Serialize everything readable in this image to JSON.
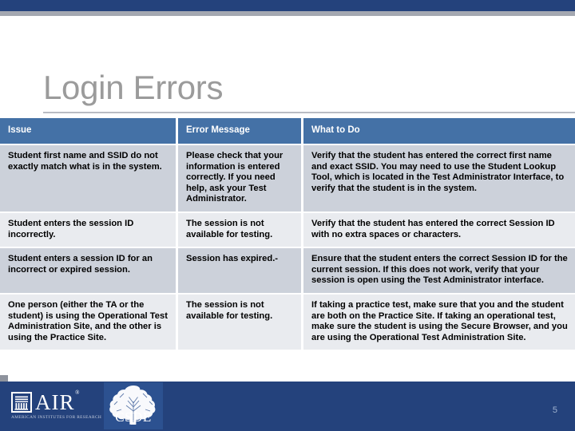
{
  "slide": {
    "title": "Login Errors",
    "page_number": "5"
  },
  "table": {
    "headers": [
      "Issue",
      "Error Message",
      "What to Do"
    ],
    "rows": [
      {
        "issue": "Student first name and SSID do not exactly match what is in the system.",
        "error_message": "Please check that your information is entered correctly. If you need help, ask your Test Administrator.",
        "what_to_do": "Verify that the student has entered the correct first name and exact SSID. You may need to use the Student Lookup Tool, which is located in the Test Administrator Interface, to verify that the student is in the system."
      },
      {
        "issue": "Student enters the session ID incorrectly.",
        "error_message": "The session is not available for testing.",
        "what_to_do": "Verify that the student has entered the correct Session ID with no extra spaces or characters."
      },
      {
        "issue": "Student enters a session ID for an incorrect or expired session.",
        "error_message": "Session has expired.-",
        "what_to_do": "Ensure that the student enters the correct Session ID for the current session. If this does not work, verify that your session is open using the Test Administrator interface."
      },
      {
        "issue": "One person (either the TA or the student) is using the Operational Test Administration Site, and the other is using the Practice Site.",
        "error_message": "The session is not available for testing.",
        "what_to_do": "If taking a practice test, make sure that you and the student are both on the Practice Site. If taking an operational test, make sure the student is using the Secure Browser, and you are using the Operational Test Administration Site."
      }
    ]
  },
  "footer": {
    "air_logo": {
      "wordmark": "AIR",
      "registered_mark": "®",
      "tagline": "AMERICAN INSTITUTES FOR RESEARCH"
    },
    "csde_logo": {
      "wordmark": "CSDE"
    }
  },
  "colors": {
    "navy_band": "#24427c",
    "gray_band": "#a4a8b1",
    "table_header": "#4471a6",
    "row_dark": "#ccd1da",
    "row_light": "#e9ebef",
    "title_gray": "#9b9b9b",
    "page_number": "#9fb2d0"
  }
}
